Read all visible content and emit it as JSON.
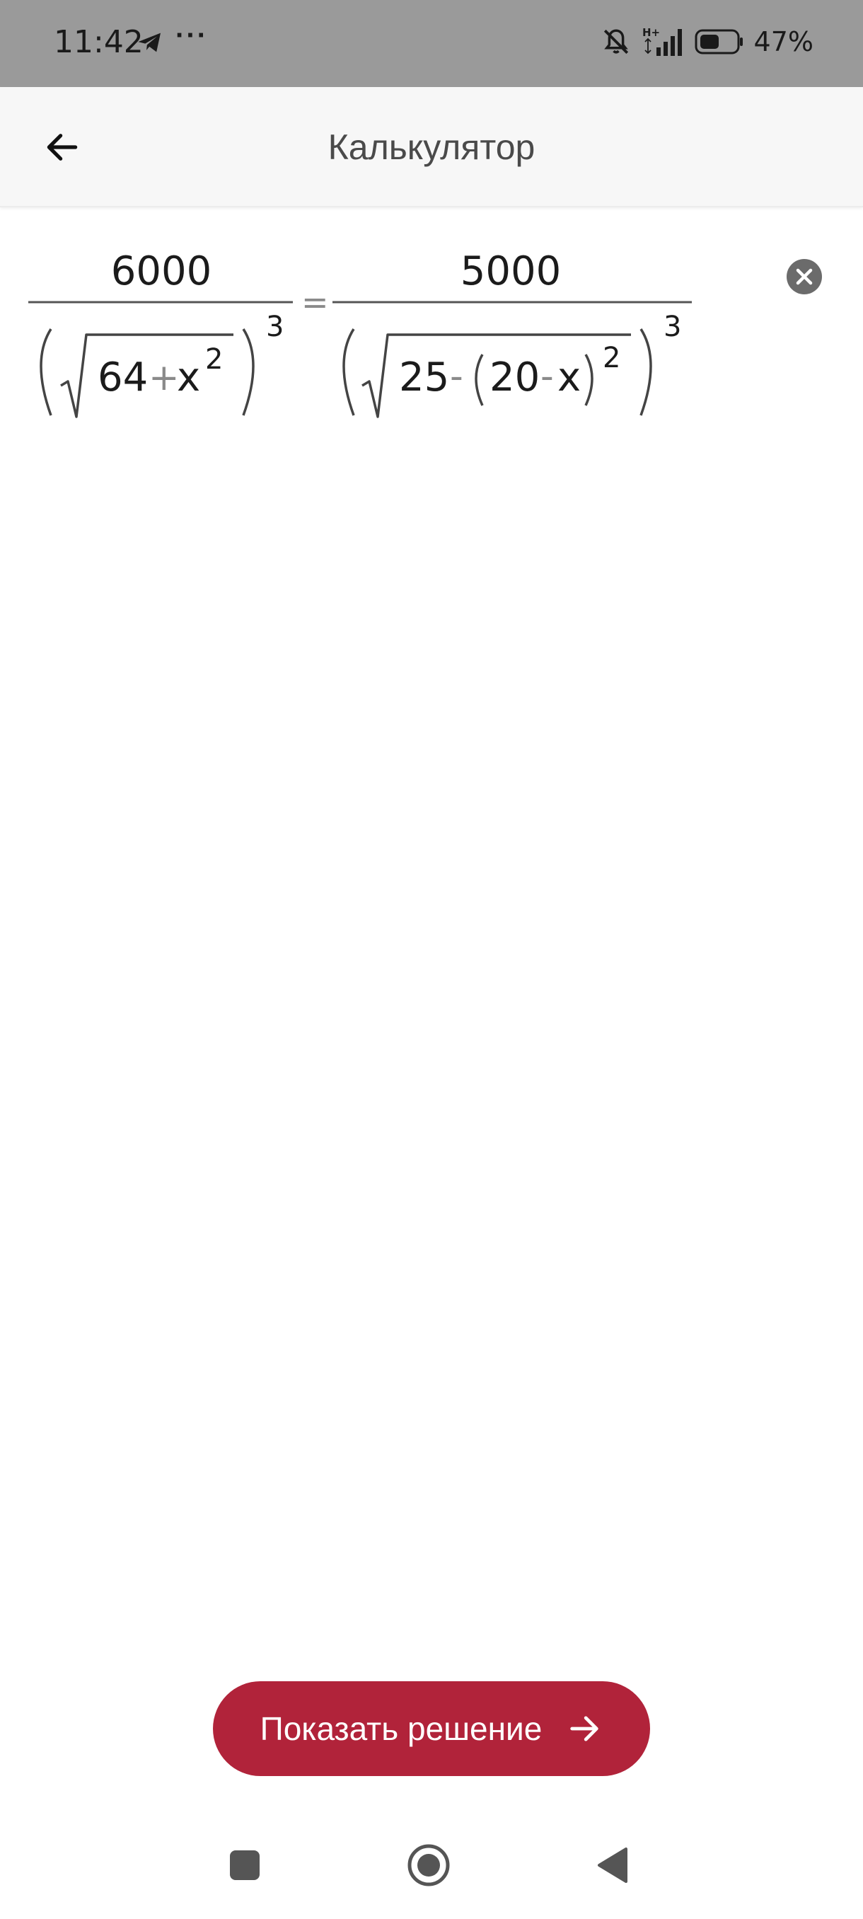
{
  "status_bar": {
    "time": "11:42",
    "more_indicator": "···",
    "network_label": "H+",
    "battery_percent": "47%"
  },
  "app_bar": {
    "title": "Калькулятор"
  },
  "formula": {
    "left_numerator": "6000",
    "left_radicand_a": "64",
    "left_operator": "+",
    "left_variable": "x",
    "left_inner_exponent": "2",
    "left_outer_exponent": "3",
    "equals": "=",
    "right_numerator": "5000",
    "right_radicand_a": "25",
    "right_operator_1": "-",
    "right_inner_a": "20",
    "right_operator_2": "-",
    "right_variable": "x",
    "right_inner_exponent": "2",
    "right_outer_exponent": "3"
  },
  "actions": {
    "show_solution_label": "Показать решение"
  },
  "colors": {
    "accent": "#b1233a",
    "status_bar_bg": "#9a9a9a",
    "app_bar_bg": "#f7f7f7"
  },
  "icons": {
    "back": "arrow-left-icon",
    "clear": "close-circle-icon",
    "action_arrow": "arrow-right-icon",
    "nav_recents": "square-icon",
    "nav_home": "circle-icon",
    "nav_back": "triangle-back-icon"
  }
}
